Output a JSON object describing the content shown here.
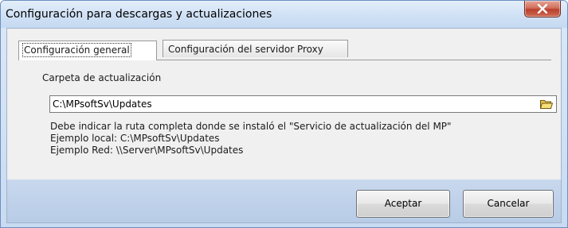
{
  "window": {
    "title": "Configuración para descargas y actualizaciones",
    "close_icon": "close-icon"
  },
  "tabs": [
    {
      "label": "Configuración general",
      "active": true
    },
    {
      "label": "Configuración del servidor Proxy",
      "active": false
    }
  ],
  "general": {
    "folder_label": "Carpeta de actualización",
    "folder_value": "C:\\MPsoftSv\\Updates",
    "browse_icon": "folder-open-icon",
    "info_lines": [
      "Debe indicar la ruta completa donde se instaló el \"Servicio de actualización del MP\"",
      "Ejemplo local: C:\\MPsoftSv\\Updates",
      "Ejemplo Red: \\\\Server\\MPsoftSv\\Updates"
    ]
  },
  "buttons": {
    "ok": "Aceptar",
    "cancel": "Cancelar"
  }
}
